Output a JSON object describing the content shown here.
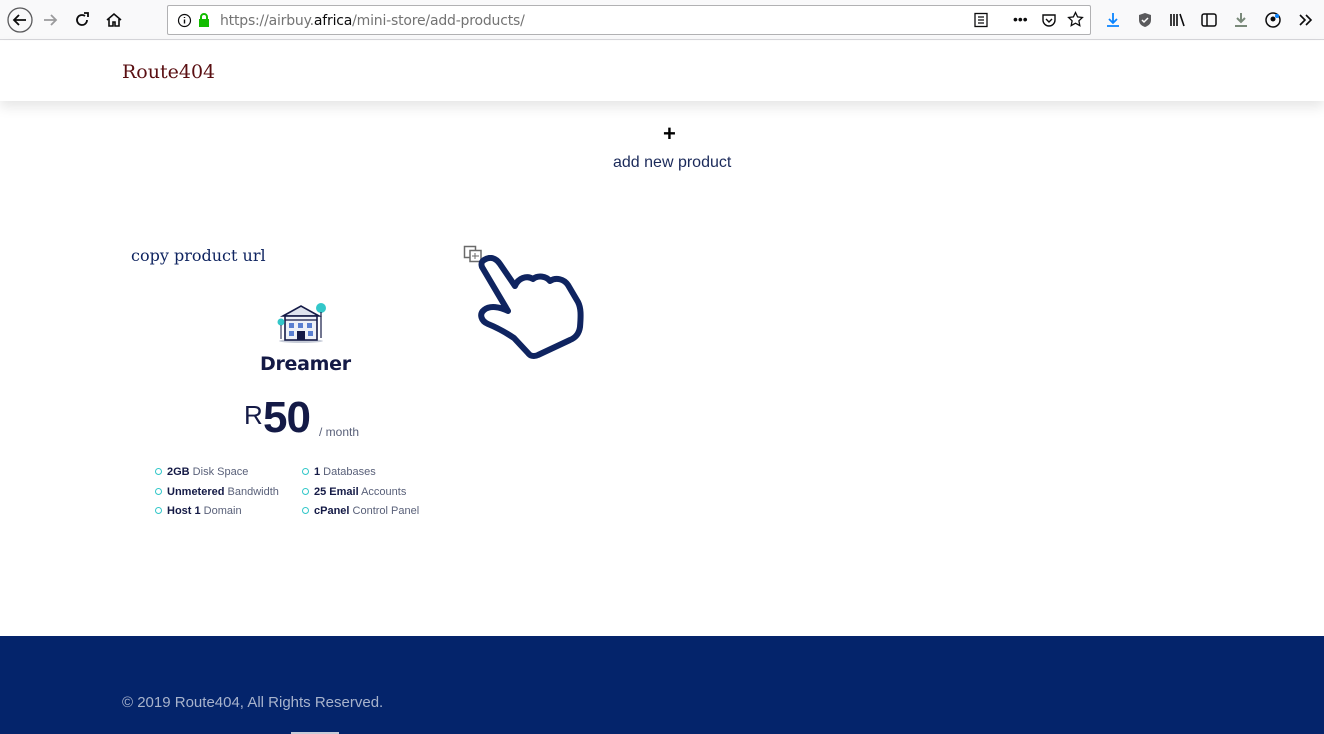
{
  "browser": {
    "url_prefix": "https://airbuy.",
    "url_domain": "africa",
    "url_path": "/mini-store/add-products/"
  },
  "site": {
    "brand": "Route404"
  },
  "main": {
    "add_icon": "+",
    "add_label": "add new product",
    "copy_url_label": "copy product url"
  },
  "plan": {
    "name": "Dreamer",
    "currency": "R",
    "price": "50",
    "period": "/ month",
    "features": [
      {
        "bold": "2GB",
        "text": " Disk Space"
      },
      {
        "bold": "Unmetered",
        "text": " Bandwidth"
      },
      {
        "bold": "Host 1",
        "text": " Domain"
      },
      {
        "bold": "1",
        "text": " Databases"
      },
      {
        "bold": "25 Email",
        "text": " Accounts"
      },
      {
        "bold": "cPanel",
        "text": " Control Panel"
      }
    ]
  },
  "footer": {
    "copyright": "© 2019 Route404, All Rights Reserved."
  },
  "colors": {
    "brand": "#5a0f12",
    "navy": "#141a46",
    "footer_bg": "#04246b",
    "accent": "#33c7c9",
    "hand": "#0f2460"
  }
}
